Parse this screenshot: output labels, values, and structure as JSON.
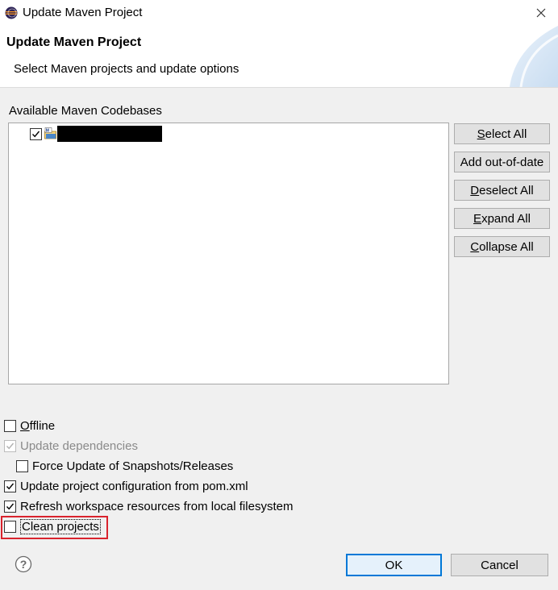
{
  "window": {
    "title": "Update Maven Project",
    "app_icon": "eclipse-icon",
    "close_icon": "close-icon"
  },
  "header": {
    "title": "Update Maven Project",
    "subtitle": "Select Maven projects and update options"
  },
  "codebases": {
    "label": "Available Maven Codebases",
    "items": [
      {
        "checked": true,
        "icon": "maven-project-folder-icon",
        "name_redacted": true
      }
    ]
  },
  "side_buttons": {
    "select_all": {
      "mnemonic": "S",
      "rest": "elect All"
    },
    "add_out_of_date": {
      "label": "Add out-of-date"
    },
    "deselect_all": {
      "mnemonic": "D",
      "rest": "eselect All"
    },
    "expand_all": {
      "mnemonic": "E",
      "rest": "xpand All"
    },
    "collapse_all": {
      "mnemonic": "C",
      "rest": "ollapse All"
    }
  },
  "options": {
    "offline": {
      "mnemonic": "O",
      "rest": "ffline",
      "checked": false
    },
    "update_dependencies": {
      "label": "Update dependencies",
      "checked": true,
      "disabled": true
    },
    "force_update": {
      "label": "Force Update of Snapshots/Releases",
      "checked": false
    },
    "update_config": {
      "label": "Update project configuration from pom.xml",
      "checked": true
    },
    "refresh_workspace": {
      "label": "Refresh workspace resources from local filesystem",
      "checked": true
    },
    "clean_projects": {
      "label": "Clean projects",
      "checked": false,
      "highlighted": true
    }
  },
  "footer": {
    "help_icon": "help-icon",
    "ok_label": "OK",
    "cancel_label": "Cancel"
  },
  "colors": {
    "highlight_border": "#d9232d",
    "default_button_border": "#0078d7",
    "default_button_bg": "#e5f1fb"
  }
}
